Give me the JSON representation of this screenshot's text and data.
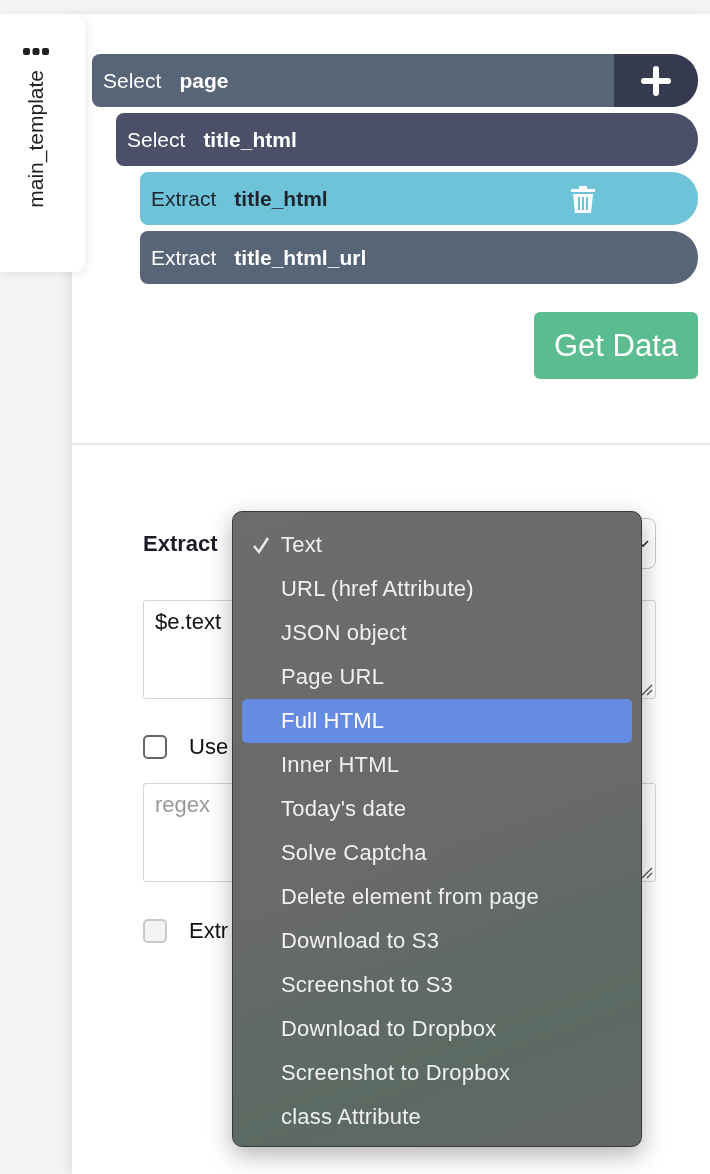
{
  "sidebar_tab": {
    "label": "main_template"
  },
  "tree": [
    {
      "action": "Select",
      "target": "page",
      "selected": false,
      "children": [
        {
          "action": "Select",
          "target": "title_html",
          "selected": false,
          "children": [
            {
              "action": "Extract",
              "target": "title_html",
              "selected": true
            },
            {
              "action": "Extract",
              "target": "title_html_url",
              "selected": false
            }
          ]
        }
      ]
    }
  ],
  "get_data_button": "Get Data",
  "form": {
    "label": "Extract",
    "code": "$e.text",
    "regex_placeholder": "regex",
    "checkboxes": [
      {
        "label": "Use",
        "checked": false,
        "disabled": false
      },
      {
        "label": "Extr",
        "checked": false,
        "disabled": true
      }
    ]
  },
  "menu": [
    {
      "label": "Text",
      "checked": true,
      "selected": false
    },
    {
      "label": "URL (href Attribute)",
      "checked": false,
      "selected": false
    },
    {
      "label": "JSON object",
      "checked": false,
      "selected": false
    },
    {
      "label": "Page URL",
      "checked": false,
      "selected": false
    },
    {
      "label": "Full HTML",
      "checked": false,
      "selected": true
    },
    {
      "label": "Inner HTML",
      "checked": false,
      "selected": false
    },
    {
      "label": "Today's date",
      "checked": false,
      "selected": false
    },
    {
      "label": "Solve Captcha",
      "checked": false,
      "selected": false
    },
    {
      "label": "Delete element from page",
      "checked": false,
      "selected": false
    },
    {
      "label": "Download to S3",
      "checked": false,
      "selected": false
    },
    {
      "label": "Screenshot to S3",
      "checked": false,
      "selected": false
    },
    {
      "label": "Download to Dropbox",
      "checked": false,
      "selected": false
    },
    {
      "label": "Screenshot to Dropbox",
      "checked": false,
      "selected": false
    },
    {
      "label": "class Attribute",
      "checked": false,
      "selected": false
    }
  ]
}
